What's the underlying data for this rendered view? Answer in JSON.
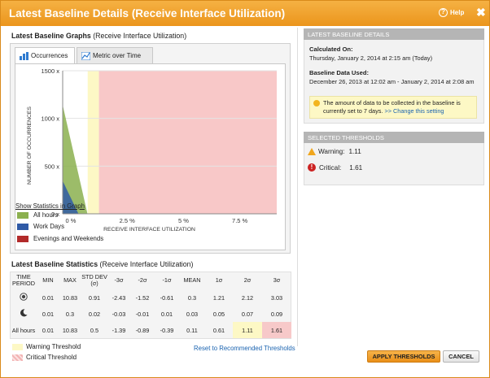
{
  "dialog": {
    "title": "Latest Baseline Details (Receive Interface Utilization)",
    "help_label": "Help",
    "close_glyph": "✖"
  },
  "graphs": {
    "title_bold": "Latest Baseline Graphs",
    "title_rest": " (Receive Interface Utilization)",
    "tabs": [
      {
        "label": "Occurrences",
        "icon": "bar-chart-icon",
        "active": true
      },
      {
        "label": "Metric over Time",
        "icon": "line-chart-icon",
        "active": false
      }
    ],
    "show_stats_link": "Show Statistics in Graph",
    "legend": [
      {
        "label": "All hours",
        "color": "#8bb04f"
      },
      {
        "label": "Work Days",
        "color": "#2f5aa6"
      },
      {
        "label": "Evenings and Weekends",
        "color": "#b22a2a"
      }
    ]
  },
  "chart_data": {
    "type": "area",
    "xlabel": "RECEIVE INTERFACE UTILIZATION",
    "ylabel": "NUMBER OF OCCURRENCES",
    "x_tick_labels": [
      "0 %",
      "2.5 %",
      "5 %",
      "7.5 %"
    ],
    "y_tick_labels": [
      "0 x",
      "500 x",
      "1000 x",
      "1500 x"
    ],
    "xlim": [
      0,
      9.5
    ],
    "ylim": [
      0,
      1500
    ],
    "grid": true,
    "series": [
      {
        "name": "All hours",
        "x": [
          0,
          0.01,
          1.1
        ],
        "y": [
          0,
          1130,
          0
        ],
        "color": "#8bb04f"
      },
      {
        "name": "Work Days",
        "x": [
          0,
          0.01,
          0.7
        ],
        "y": [
          0,
          340,
          0
        ],
        "color": "#2f5aa6"
      }
    ],
    "threshold_regions": [
      {
        "name": "Warning Threshold",
        "from": 1.11,
        "to": 1.61,
        "color": "#fdf8c5"
      },
      {
        "name": "Critical Threshold",
        "from": 1.61,
        "to": 9.5,
        "color": "#f8c8c8"
      }
    ]
  },
  "stats": {
    "title_bold": "Latest Baseline Statistics",
    "title_rest": " (Receive Interface Utilization)",
    "headers": [
      "TIME PERIOD",
      "MIN",
      "MAX",
      "STD DEV (σ)",
      "-3σ",
      "-2σ",
      "-1σ",
      "MEAN",
      "1σ",
      "2σ",
      "3σ"
    ],
    "rows": [
      {
        "period_icon": "sun-icon",
        "period": "",
        "values": [
          "0.01",
          "10.83",
          "0.91",
          "-2.43",
          "-1.52",
          "-0.61",
          "0.3",
          "1.21",
          "2.12",
          "3.03"
        ]
      },
      {
        "period_icon": "moon-icon",
        "period": "",
        "values": [
          "0.01",
          "0.3",
          "0.02",
          "-0.03",
          "-0.01",
          "0.01",
          "0.03",
          "0.05",
          "0.07",
          "0.09"
        ]
      },
      {
        "period_icon": "",
        "period": "All hours",
        "values": [
          "0.01",
          "10.83",
          "0.5",
          "-1.39",
          "-0.89",
          "-0.39",
          "0.11",
          "0.61",
          "1.11",
          "1.61"
        ]
      }
    ],
    "warning_threshold_label": "Warning Threshold",
    "critical_threshold_label": "Critical Threshold",
    "reset_link": "Reset to Recommended Thresholds",
    "warning_color": "#fdf8c5",
    "critical_color": "#f7c9c9"
  },
  "details": {
    "header": "LATEST BASELINE DETAILS",
    "calculated_label": "Calculated On:",
    "calculated_value": "Thursday, January 2, 2014 at 2:15 am (Today)",
    "used_label": "Baseline Data Used:",
    "used_value": "December 26, 2013 at 12:02 am - January 2, 2014 at 2:08 am",
    "note_text": "The amount of data to be collected in the baseline is currently set to 7 days.",
    "note_link": ">> Change this setting"
  },
  "thresholds": {
    "header": "SELECTED THRESHOLDS",
    "warning_label": "Warning:",
    "warning_value": "1.11",
    "critical_label": "Critical:",
    "critical_value": "1.61"
  },
  "buttons": {
    "apply": "APPLY THRESHOLDS",
    "cancel": "CANCEL"
  }
}
